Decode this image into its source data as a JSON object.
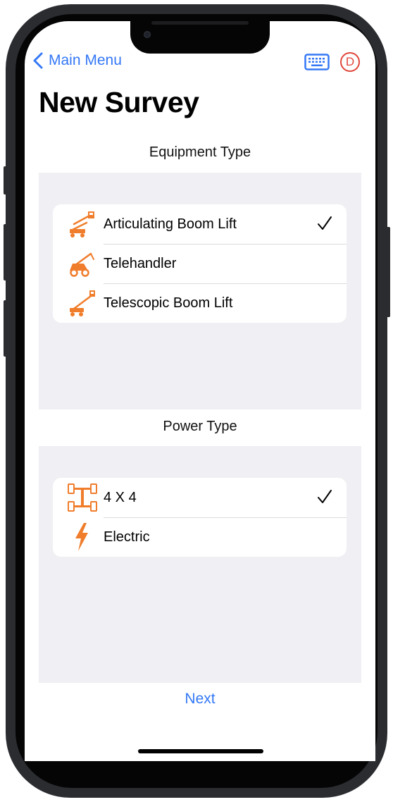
{
  "nav": {
    "back_label": "Main Menu",
    "avatar_letter": "D"
  },
  "page": {
    "title": "New Survey"
  },
  "equipment": {
    "heading": "Equipment Type",
    "items": [
      {
        "label": "Articulating Boom Lift",
        "icon": "articulating-boom-lift-icon",
        "selected": true
      },
      {
        "label": "Telehandler",
        "icon": "telehandler-icon",
        "selected": false
      },
      {
        "label": "Telescopic Boom Lift",
        "icon": "telescopic-boom-lift-icon",
        "selected": false
      }
    ]
  },
  "power": {
    "heading": "Power Type",
    "items": [
      {
        "label": "4 X 4",
        "icon": "four-by-four-axle-icon",
        "selected": true
      },
      {
        "label": "Electric",
        "icon": "lightning-bolt-icon",
        "selected": false
      }
    ]
  },
  "footer": {
    "next_label": "Next"
  },
  "colors": {
    "accent": "#3478f6",
    "icon_orange": "#f07d2c",
    "avatar_red": "#e0473c",
    "panel_bg": "#f0f0f4"
  }
}
